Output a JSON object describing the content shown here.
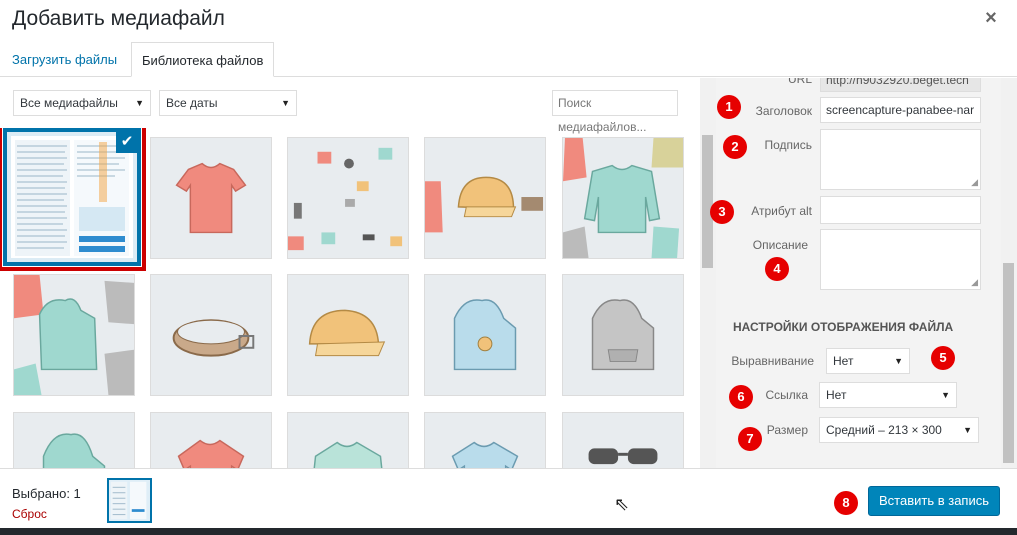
{
  "header": {
    "title": "Добавить медиафайл",
    "close_icon": "×"
  },
  "tabs": [
    {
      "label": "Загрузить файлы",
      "active": false
    },
    {
      "label": "Библиотека файлов",
      "active": true
    }
  ],
  "toolbar": {
    "filter_type": "Все медиафайлы",
    "filter_date": "Все даты",
    "search_placeholder": "Поиск медиафайлов..."
  },
  "grid": {
    "items": [
      {
        "kind": "screenshot",
        "selected": true
      },
      {
        "kind": "tshirt-red"
      },
      {
        "kind": "pattern"
      },
      {
        "kind": "cap-beanie"
      },
      {
        "kind": "longsleeve"
      },
      {
        "kind": "hoodie-pattern"
      },
      {
        "kind": "belt"
      },
      {
        "kind": "cap-yellow"
      },
      {
        "kind": "hoodie-blue"
      },
      {
        "kind": "hoodie-gray"
      },
      {
        "kind": "hoodie-green"
      },
      {
        "kind": "polo-red"
      },
      {
        "kind": "longsleeve-green"
      },
      {
        "kind": "polo-blue"
      },
      {
        "kind": "sunglasses"
      }
    ]
  },
  "details": {
    "url_label": "URL",
    "url_value": "http://h9032920.beget.tech",
    "title_label": "Заголовок",
    "title_value": "screencapture-panabee-nar",
    "caption_label": "Подпись",
    "alt_label": "Атрибут alt",
    "description_label": "Описание"
  },
  "display_settings": {
    "heading": "Настройки отображения файла",
    "align_label": "Выравнивание",
    "align_value": "Нет",
    "link_label": "Ссылка",
    "link_value": "Нет",
    "size_label": "Размер",
    "size_value": "Средний – 213 × 300"
  },
  "badges": [
    "1",
    "2",
    "3",
    "4",
    "5",
    "6",
    "7",
    "8"
  ],
  "footer": {
    "selected_text": "Выбрано: 1",
    "reset_text": "Сброс",
    "insert_button": "Вставить в запись"
  },
  "colors": {
    "accent": "#0073aa",
    "button": "#0085ba",
    "badge": "#e60000",
    "selection_outline": "#cc0000"
  }
}
